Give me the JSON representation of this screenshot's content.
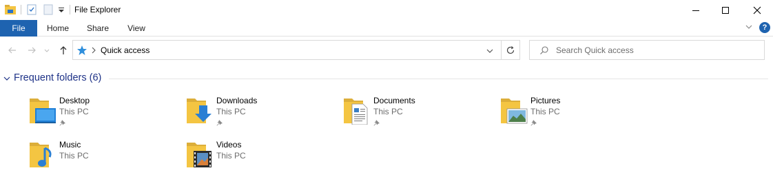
{
  "window": {
    "title": "File Explorer",
    "controls": {
      "minimize": "minimize",
      "maximize": "maximize",
      "close": "close"
    }
  },
  "ribbon": {
    "tabs": [
      {
        "label": "File",
        "active": true
      },
      {
        "label": "Home"
      },
      {
        "label": "Share"
      },
      {
        "label": "View"
      }
    ],
    "help_symbol": "?"
  },
  "address": {
    "location": "Quick access",
    "search_placeholder": "Search Quick access"
  },
  "group": {
    "title": "Frequent folders (6)"
  },
  "folders": [
    {
      "name": "Desktop",
      "location": "This PC",
      "pinned": true,
      "icon": "desktop-folder-icon"
    },
    {
      "name": "Downloads",
      "location": "This PC",
      "pinned": true,
      "icon": "downloads-folder-icon"
    },
    {
      "name": "Documents",
      "location": "This PC",
      "pinned": true,
      "icon": "documents-folder-icon"
    },
    {
      "name": "Pictures",
      "location": "This PC",
      "pinned": true,
      "icon": "pictures-folder-icon"
    },
    {
      "name": "Music",
      "location": "This PC",
      "pinned": false,
      "icon": "music-folder-icon"
    },
    {
      "name": "Videos",
      "location": "This PC",
      "pinned": false,
      "icon": "videos-folder-icon"
    }
  ],
  "colors": {
    "file_tab": "#1e63b0",
    "group_title": "#1e3287",
    "folder_yellow": "#f4c542",
    "folder_back": "#dcae3a",
    "quick_access_star": "#2f8fdc"
  }
}
